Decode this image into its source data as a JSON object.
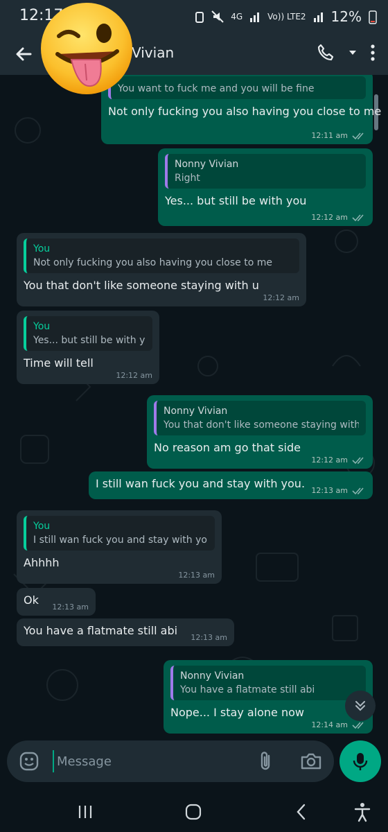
{
  "status": {
    "time": "12:17",
    "network": "4G",
    "network2": "Vo)) LTE2",
    "battery": "12%"
  },
  "header": {
    "contact_name": "Vivian"
  },
  "messages": [
    {
      "dir": "out",
      "quote_text": "You want to fuck me and you will be fine",
      "text": "Not only fucking you also having you close to me",
      "time": "12:11 am"
    },
    {
      "dir": "out",
      "quote_author": "Nonny Vivian",
      "quote_text": "Right",
      "text": "Yes... but still be with you",
      "time": "12:12 am"
    },
    {
      "dir": "in",
      "quote_author": "You",
      "quote_text": "Not only fucking you also having you close to me",
      "text": "You that don't like someone staying with u",
      "time": "12:12 am"
    },
    {
      "dir": "in",
      "quote_author": "You",
      "quote_text": "Yes... but still be with you",
      "text": "Time will tell",
      "time": "12:12 am"
    },
    {
      "dir": "out",
      "quote_author": "Nonny Vivian",
      "quote_text": "You that don't like someone staying with u",
      "text": "No reason am go that side",
      "time": "12:12 am"
    },
    {
      "dir": "out",
      "text": "I still wan fuck you and stay with you.",
      "time": "12:13 am"
    },
    {
      "dir": "in",
      "quote_author": "You",
      "quote_text": "I still wan fuck you and stay with you.",
      "text": "Ahhhh",
      "time": "12:13 am"
    },
    {
      "dir": "in",
      "text": "Ok",
      "time": "12:13 am"
    },
    {
      "dir": "in",
      "text": "You have a flatmate still abi",
      "time": "12:13 am"
    },
    {
      "dir": "out",
      "quote_author": "Nonny Vivian",
      "quote_text": "You have a flatmate still abi",
      "text": "Nope... I stay alone now",
      "time": "12:14 am"
    }
  ],
  "composer": {
    "placeholder": "Message"
  },
  "icons": {
    "back": "arrow-left-icon",
    "call": "phone-icon",
    "dropdown": "chevron-down-icon",
    "menu": "more-vertical-icon",
    "emoji": "sticker-icon",
    "attach": "paperclip-icon",
    "camera": "camera-icon",
    "mic": "mic-icon",
    "scroll_down": "double-chevron-down-icon"
  },
  "colors": {
    "background": "#0b141a",
    "bubble_out": "#005c4b",
    "bubble_in": "#202c33",
    "accent": "#00a884",
    "read_tick": "#53bdeb"
  }
}
